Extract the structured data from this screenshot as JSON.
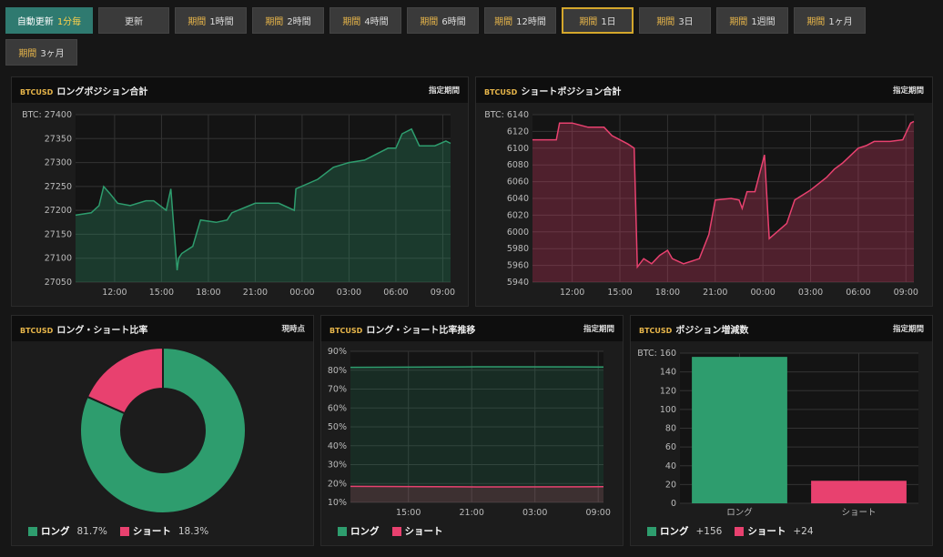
{
  "toolbar": {
    "auto_label": "自動更新",
    "auto_value": "1分毎",
    "refresh_label": "更新",
    "period_prefix": "期間",
    "periods": [
      "1時間",
      "2時間",
      "4時間",
      "6時間",
      "12時間",
      "1日",
      "3日",
      "1週間",
      "1ヶ月",
      "3ヶ月"
    ],
    "active_period": "1日"
  },
  "panels": {
    "long": {
      "symbol": "BTCUSD",
      "title": "ロングポジション合計",
      "right": "指定期間"
    },
    "short": {
      "symbol": "BTCUSD",
      "title": "ショートポジション合計",
      "right": "指定期間"
    },
    "ratio": {
      "symbol": "BTCUSD",
      "title": "ロング・ショート比率",
      "right": "現時点"
    },
    "trend": {
      "symbol": "BTCUSD",
      "title": "ロング・ショート比率推移",
      "right": "指定期間"
    },
    "change": {
      "symbol": "BTCUSD",
      "title": "ポジション増減数",
      "right": "指定期間"
    }
  },
  "legend": {
    "long_label": "ロング",
    "short_label": "ショート",
    "ratio_long": "81.7%",
    "ratio_short": "18.3%",
    "change_long": "+156",
    "change_short": "+24"
  },
  "colors": {
    "long": "#2e9d6e",
    "short": "#e8416f",
    "accent": "#e8b64a"
  },
  "chart_data": [
    {
      "id": "long",
      "type": "area",
      "ylabel": "BTC:",
      "ylim": [
        27050,
        27400
      ],
      "yticks": [
        27050,
        27100,
        27150,
        27200,
        27250,
        27300,
        27350,
        27400
      ],
      "xticks": [
        "12:00",
        "15:00",
        "18:00",
        "21:00",
        "00:00",
        "03:00",
        "06:00",
        "09:00"
      ],
      "x_range": [
        9.5,
        33.5
      ],
      "x": [
        9.5,
        10.5,
        11.0,
        11.3,
        11.7,
        12.2,
        13.0,
        14.0,
        14.5,
        15.3,
        15.6,
        16.0,
        16.1,
        16.3,
        17.0,
        17.5,
        18.5,
        19.2,
        19.5,
        21.0,
        22.5,
        23.5,
        23.6,
        25.0,
        26.0,
        27.0,
        28.0,
        29.5,
        30.0,
        30.4,
        31.0,
        31.5,
        32.5,
        33.2,
        33.5
      ],
      "y": [
        27190,
        27195,
        27210,
        27250,
        27235,
        27215,
        27210,
        27220,
        27220,
        27200,
        27245,
        27075,
        27100,
        27110,
        27125,
        27180,
        27175,
        27180,
        27195,
        27215,
        27215,
        27200,
        27245,
        27265,
        27290,
        27300,
        27305,
        27330,
        27330,
        27360,
        27370,
        27335,
        27335,
        27345,
        27340
      ],
      "color": "#2e9d6e"
    },
    {
      "id": "short",
      "type": "area",
      "ylabel": "BTC:",
      "ylim": [
        5940,
        6140
      ],
      "yticks": [
        5940,
        5960,
        5980,
        6000,
        6020,
        6040,
        6060,
        6080,
        6100,
        6120,
        6140
      ],
      "xticks": [
        "12:00",
        "15:00",
        "18:00",
        "21:00",
        "00:00",
        "03:00",
        "06:00",
        "09:00"
      ],
      "x_range": [
        9.5,
        33.5
      ],
      "x": [
        9.5,
        10.0,
        11.0,
        11.2,
        12.0,
        13.0,
        14.0,
        14.5,
        15.5,
        15.9,
        16.1,
        16.5,
        17.0,
        17.5,
        18.0,
        18.3,
        19.0,
        20.0,
        20.6,
        21.0,
        22.0,
        22.5,
        22.7,
        23.0,
        23.5,
        24.1,
        24.4,
        25.5,
        26.0,
        27.0,
        28.0,
        28.5,
        29.0,
        30.0,
        30.5,
        31.0,
        32.0,
        32.8,
        33.3,
        33.5
      ],
      "y": [
        6110,
        6110,
        6110,
        6130,
        6130,
        6125,
        6125,
        6115,
        6105,
        6100,
        5958,
        5968,
        5962,
        5972,
        5978,
        5968,
        5962,
        5968,
        5997,
        6038,
        6040,
        6038,
        6028,
        6048,
        6048,
        6092,
        5992,
        6010,
        6038,
        6050,
        6065,
        6075,
        6082,
        6100,
        6103,
        6108,
        6108,
        6110,
        6130,
        6132
      ],
      "color": "#e8416f"
    },
    {
      "id": "ratio",
      "type": "pie",
      "categories": [
        "ロング",
        "ショート"
      ],
      "values": [
        81.7,
        18.3
      ]
    },
    {
      "id": "trend",
      "type": "area",
      "ylim": [
        10,
        90
      ],
      "yticks": [
        10,
        20,
        30,
        40,
        50,
        60,
        70,
        80,
        90
      ],
      "xticks": [
        "15:00",
        "21:00",
        "03:00",
        "09:00"
      ],
      "x_range": [
        9.5,
        33.5
      ],
      "series": [
        {
          "name": "ロング",
          "x": [
            9.5,
            21.5,
            33.5
          ],
          "values": [
            81.5,
            81.8,
            81.7
          ],
          "color": "#2e9d6e"
        },
        {
          "name": "ショート",
          "x": [
            9.5,
            21.5,
            33.5
          ],
          "values": [
            18.5,
            18.2,
            18.3
          ],
          "color": "#e8416f"
        }
      ]
    },
    {
      "id": "change",
      "type": "bar",
      "ylabel": "BTC:",
      "ylim": [
        0,
        160
      ],
      "yticks": [
        0,
        20,
        40,
        60,
        80,
        100,
        120,
        140,
        160
      ],
      "categories": [
        "ロング",
        "ショート"
      ],
      "values": [
        156,
        24
      ]
    }
  ]
}
